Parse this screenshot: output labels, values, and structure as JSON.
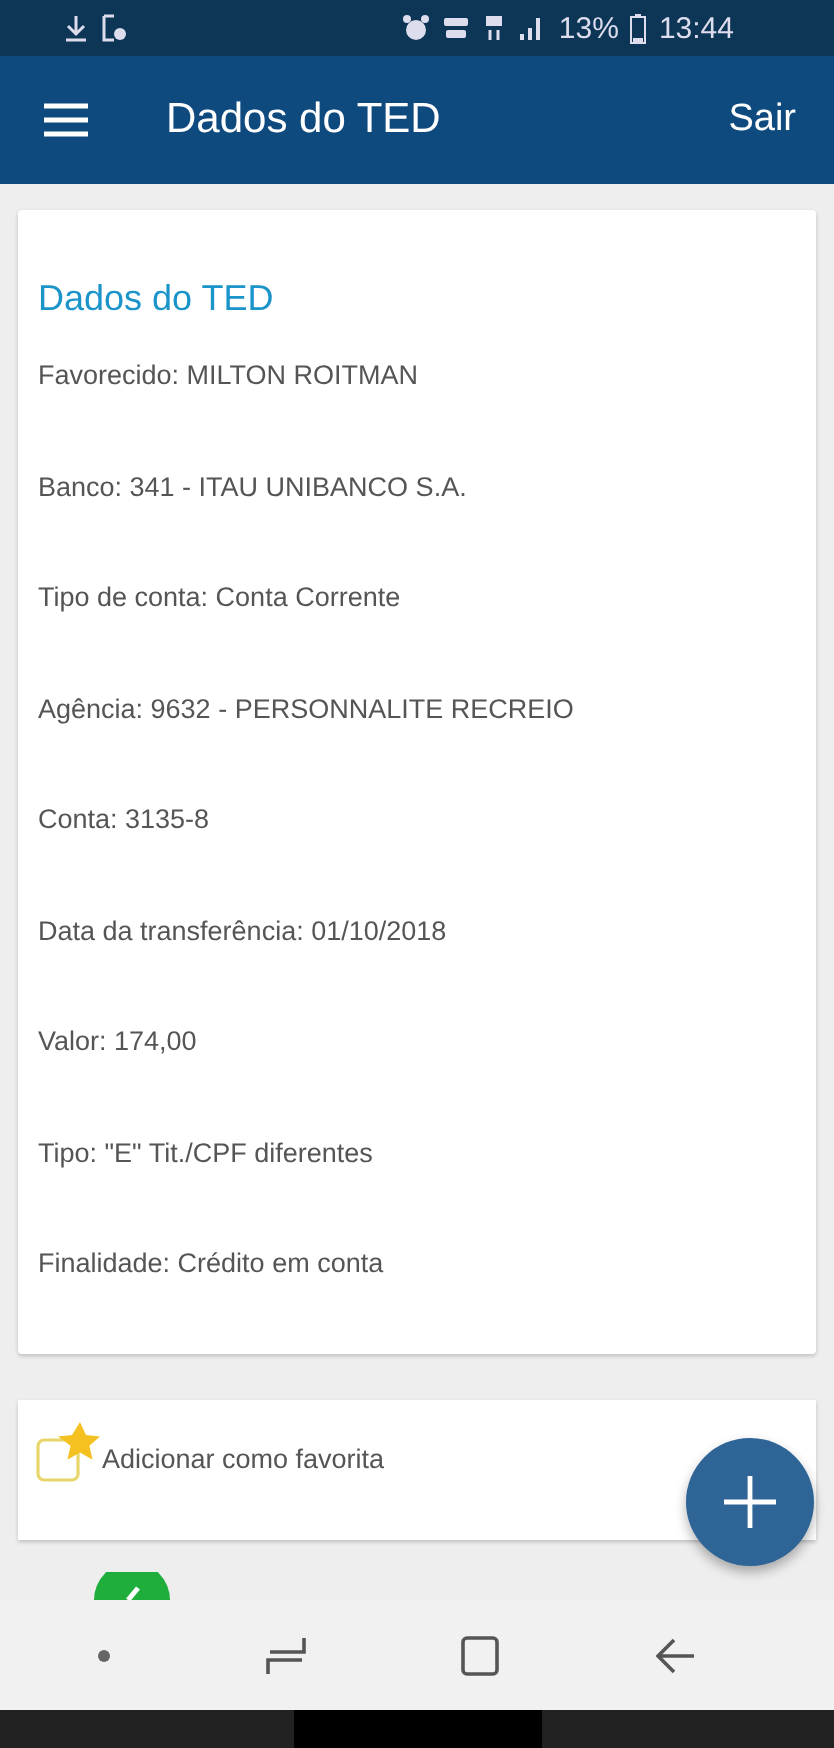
{
  "status_bar": {
    "battery": "13%",
    "time": "13:44"
  },
  "app_bar": {
    "title": "Dados do TED",
    "action": "Sair"
  },
  "details": {
    "title": "Dados do TED",
    "fields": [
      {
        "label": "Favorecido:",
        "value": "MILTON ROITMAN"
      },
      {
        "label": "Banco:",
        "value": "341 - ITAU UNIBANCO S.A."
      },
      {
        "label": "Tipo de conta:",
        "value": "Conta Corrente"
      },
      {
        "label": "Agência:",
        "value": "9632 - PERSONNALITE RECREIO"
      },
      {
        "label": "Conta:",
        "value": "3135-8"
      },
      {
        "label": "Data da transferência:",
        "value": "01/10/2018"
      },
      {
        "label": "Valor:",
        "value": "174,00"
      },
      {
        "label": "Tipo:",
        "value": "\"E\" Tit./CPF diferentes"
      },
      {
        "label": "Finalidade:",
        "value": "Crédito em conta"
      }
    ]
  },
  "favorite": {
    "label": "Adicionar como favorita"
  }
}
